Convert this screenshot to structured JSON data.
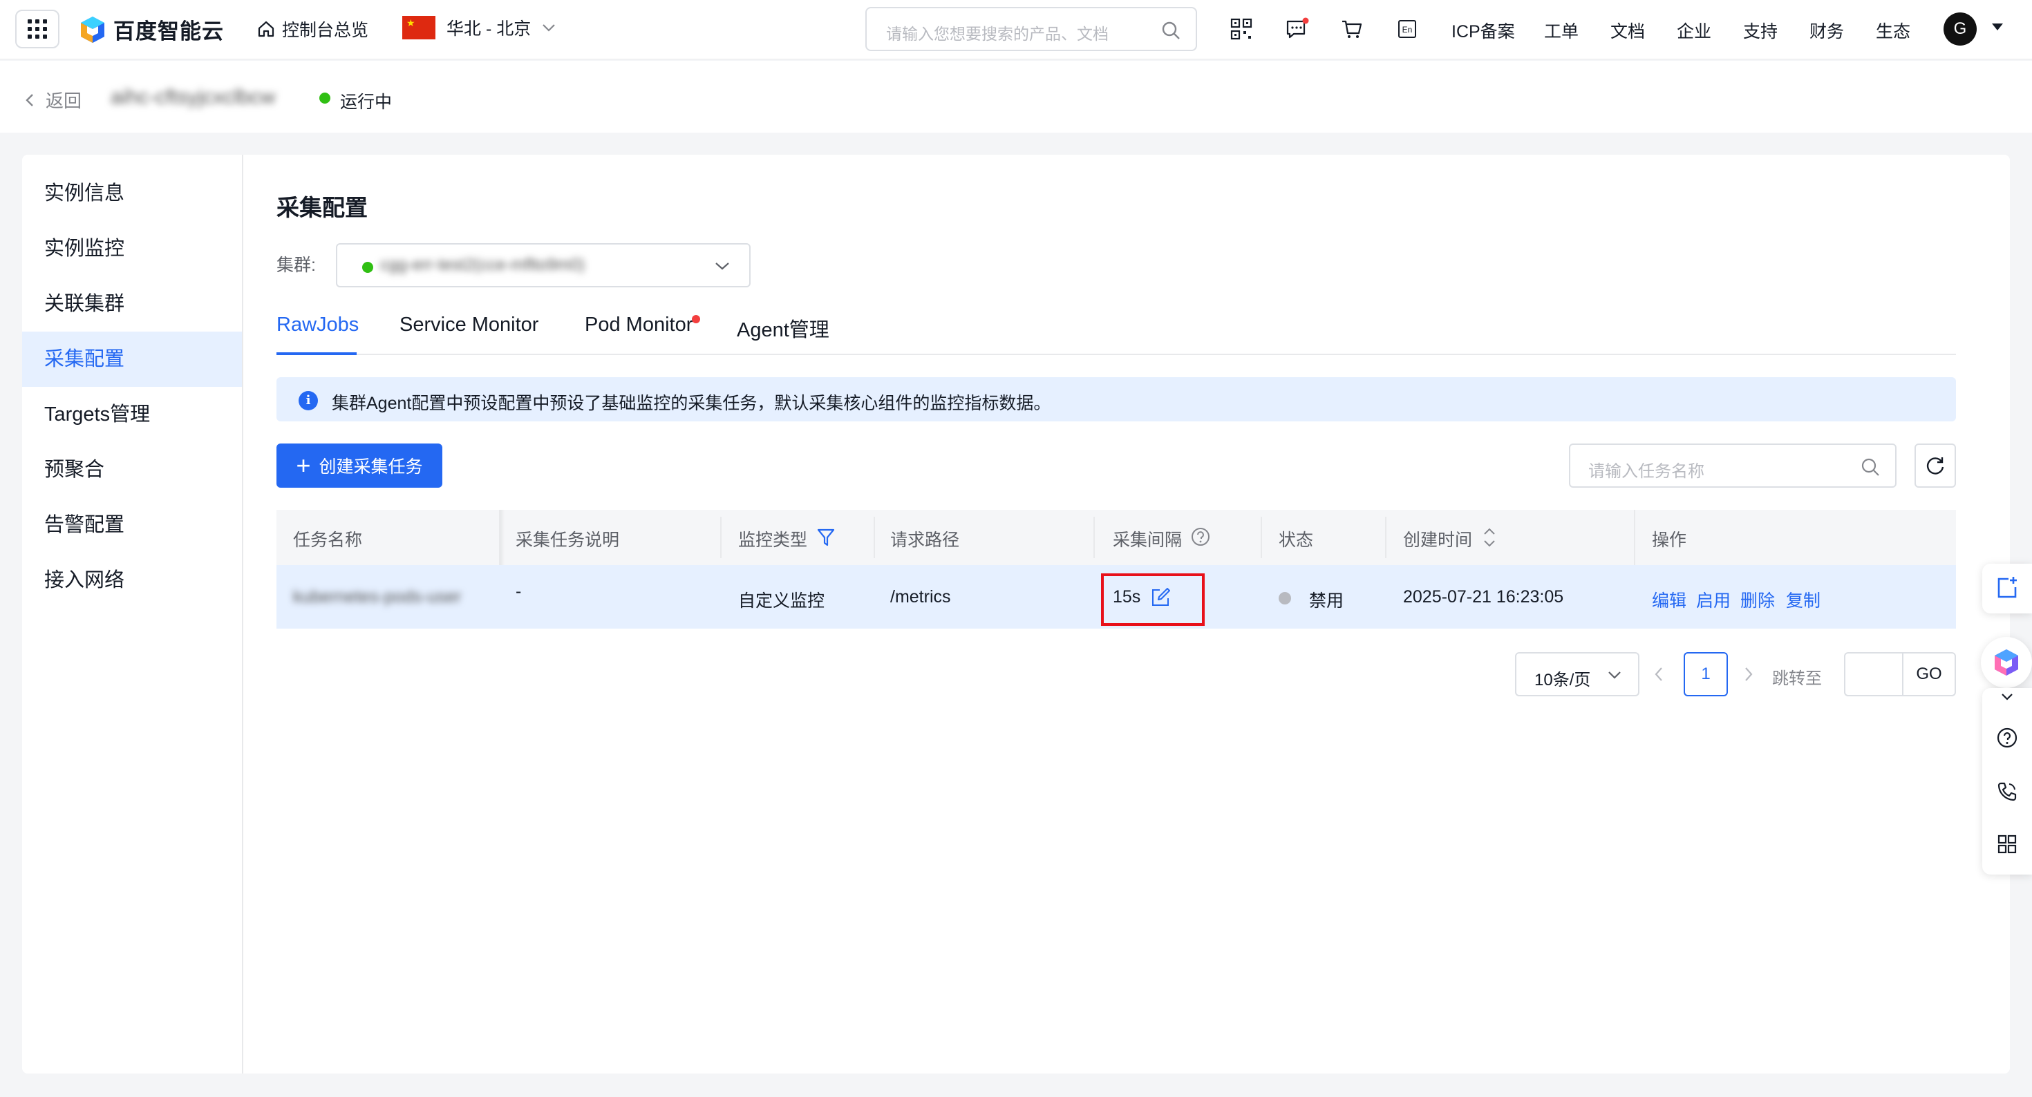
{
  "header": {
    "logo_text": "百度智能云",
    "console_home": "控制台总览",
    "region": "华北 - 北京",
    "search_placeholder": "请输入您想要搜索的产品、文档",
    "nav": [
      "ICP备案",
      "工单",
      "文档",
      "企业",
      "支持",
      "财务",
      "生态"
    ],
    "avatar_letter": "G",
    "icons": [
      "qrcode-icon",
      "message-icon",
      "cart-icon",
      "language-en-icon"
    ]
  },
  "breadcrumb": {
    "back_label": "返回",
    "instance_name": "aihc-cftsyjcxclbcw",
    "status": "运行中"
  },
  "sidebar": {
    "items": [
      {
        "label": "实例信息",
        "active": false
      },
      {
        "label": "实例监控",
        "active": false
      },
      {
        "label": "关联集群",
        "active": false
      },
      {
        "label": "采集配置",
        "active": true
      },
      {
        "label": "Targets管理",
        "active": false
      },
      {
        "label": "预聚合",
        "active": false
      },
      {
        "label": "告警配置",
        "active": false
      },
      {
        "label": "接入网络",
        "active": false
      }
    ]
  },
  "main": {
    "title": "采集配置",
    "cluster_label": "集群:",
    "cluster_value": "cgg-err-test2(cce-mflto9m0)",
    "tabs": [
      {
        "label": "RawJobs",
        "active": true
      },
      {
        "label": "Service Monitor",
        "active": false
      },
      {
        "label": "Pod Monitor",
        "active": false,
        "badge": true
      },
      {
        "label": "Agent管理",
        "active": false
      }
    ],
    "info_text": "集群Agent配置中预设配置中预设了基础监控的采集任务，默认采集核心组件的监控指标数据。",
    "create_button": "创建采集任务",
    "task_search_placeholder": "请输入任务名称"
  },
  "table": {
    "columns": [
      "任务名称",
      "采集任务说明",
      "监控类型",
      "请求路径",
      "采集间隔",
      "状态",
      "创建时间",
      "操作"
    ],
    "rows": [
      {
        "name": "kubernetes-pods-user",
        "description": "-",
        "type": "自定义监控",
        "path": "/metrics",
        "interval": "15s",
        "status": "禁用",
        "created": "2025-07-21 16:23:05",
        "actions": [
          "编辑",
          "启用",
          "删除",
          "复制"
        ]
      }
    ]
  },
  "pagination": {
    "page_size": "10条/页",
    "current_page": "1",
    "jump_label": "跳转至",
    "go_label": "GO"
  },
  "colors": {
    "primary": "#2468f2",
    "running": "#30bf13",
    "disabled": "#b8bac0",
    "highlight_box": "#e8101a",
    "badge": "#f33e3e"
  }
}
